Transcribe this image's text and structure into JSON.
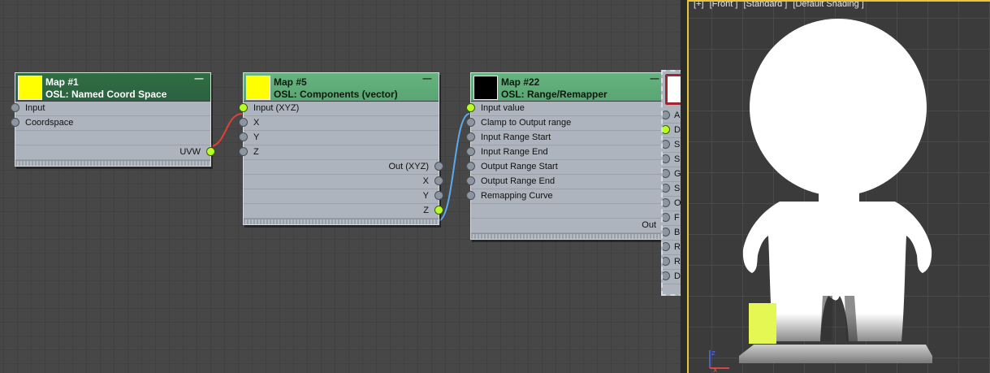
{
  "colors": {
    "socket_on": "#b8ff28",
    "socket_off": "#8d96a0",
    "wire_red": "#e0413a",
    "wire_blue": "#5aaaf0",
    "swatch_yellow": "#ffff00",
    "swatch_black": "#000000",
    "viewport_border": "#e8c53a"
  },
  "nodes": {
    "map1": {
      "title": "Map #1",
      "type": "OSL: Named Coord Space",
      "inputs": [
        "Input",
        "Coordspace"
      ],
      "output": "UVW"
    },
    "map5": {
      "title": "Map #5",
      "type": "OSL: Components (vector)",
      "inputs": [
        "Input (XYZ)",
        "X",
        "Y",
        "Z"
      ],
      "outputs": [
        "Out (XYZ)",
        "X",
        "Y",
        "Z"
      ]
    },
    "map22": {
      "title": "Map #22",
      "type": "OSL: Range/Remapper",
      "inputs": [
        "Input value",
        "Clamp to Output range",
        "Input Range Start",
        "Input Range End",
        "Output Range Start",
        "Output Range End",
        "Remapping Curve"
      ],
      "output": "Out"
    },
    "material": {
      "inputs": [
        "A",
        "D",
        "S",
        "S",
        "G",
        "S",
        "O",
        "F",
        "B",
        "R",
        "R",
        "D"
      ]
    }
  },
  "viewport": {
    "labels": [
      "[+]",
      "[Front ]",
      "[Standard ]",
      "[Default Shading ]"
    ],
    "axis": {
      "z": "z",
      "x": "x"
    }
  }
}
